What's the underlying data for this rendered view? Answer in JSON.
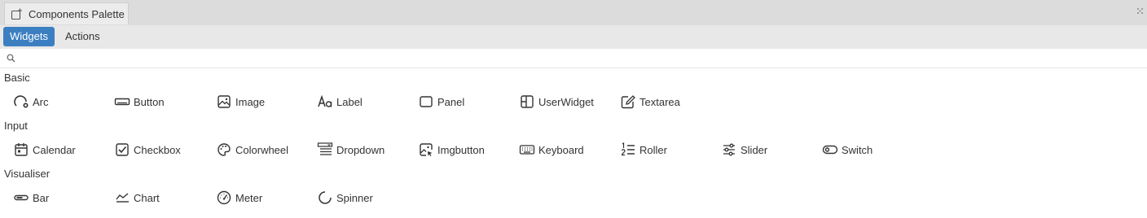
{
  "panel": {
    "title": "Components Palette",
    "icon": "add-component-icon"
  },
  "tabs": [
    {
      "label": "Widgets",
      "active": true
    },
    {
      "label": "Actions",
      "active": false
    }
  ],
  "search": {
    "value": "",
    "placeholder": "",
    "icon": "search-icon"
  },
  "sections": [
    {
      "title": "Basic",
      "items": [
        {
          "label": "Arc",
          "icon": "arc-icon"
        },
        {
          "label": "Button",
          "icon": "button-icon"
        },
        {
          "label": "Image",
          "icon": "image-icon"
        },
        {
          "label": "Label",
          "icon": "label-icon"
        },
        {
          "label": "Panel",
          "icon": "panel-icon"
        },
        {
          "label": "UserWidget",
          "icon": "userwidget-icon"
        },
        {
          "label": "Textarea",
          "icon": "textarea-icon"
        }
      ]
    },
    {
      "title": "Input",
      "items": [
        {
          "label": "Calendar",
          "icon": "calendar-icon"
        },
        {
          "label": "Checkbox",
          "icon": "checkbox-icon"
        },
        {
          "label": "Colorwheel",
          "icon": "colorwheel-icon"
        },
        {
          "label": "Dropdown",
          "icon": "dropdown-icon"
        },
        {
          "label": "Imgbutton",
          "icon": "imgbutton-icon"
        },
        {
          "label": "Keyboard",
          "icon": "keyboard-icon"
        },
        {
          "label": "Roller",
          "icon": "roller-icon"
        },
        {
          "label": "Slider",
          "icon": "slider-icon"
        },
        {
          "label": "Switch",
          "icon": "switch-icon"
        }
      ]
    },
    {
      "title": "Visualiser",
      "items": [
        {
          "label": "Bar",
          "icon": "bar-icon"
        },
        {
          "label": "Chart",
          "icon": "chart-icon"
        },
        {
          "label": "Meter",
          "icon": "meter-icon"
        },
        {
          "label": "Spinner",
          "icon": "spinner-icon"
        }
      ]
    }
  ],
  "colors": {
    "accent": "#3c7fc1",
    "header_bg": "#dcdcdc",
    "subtabs_bg": "#e8e8e8",
    "text": "#333333"
  }
}
